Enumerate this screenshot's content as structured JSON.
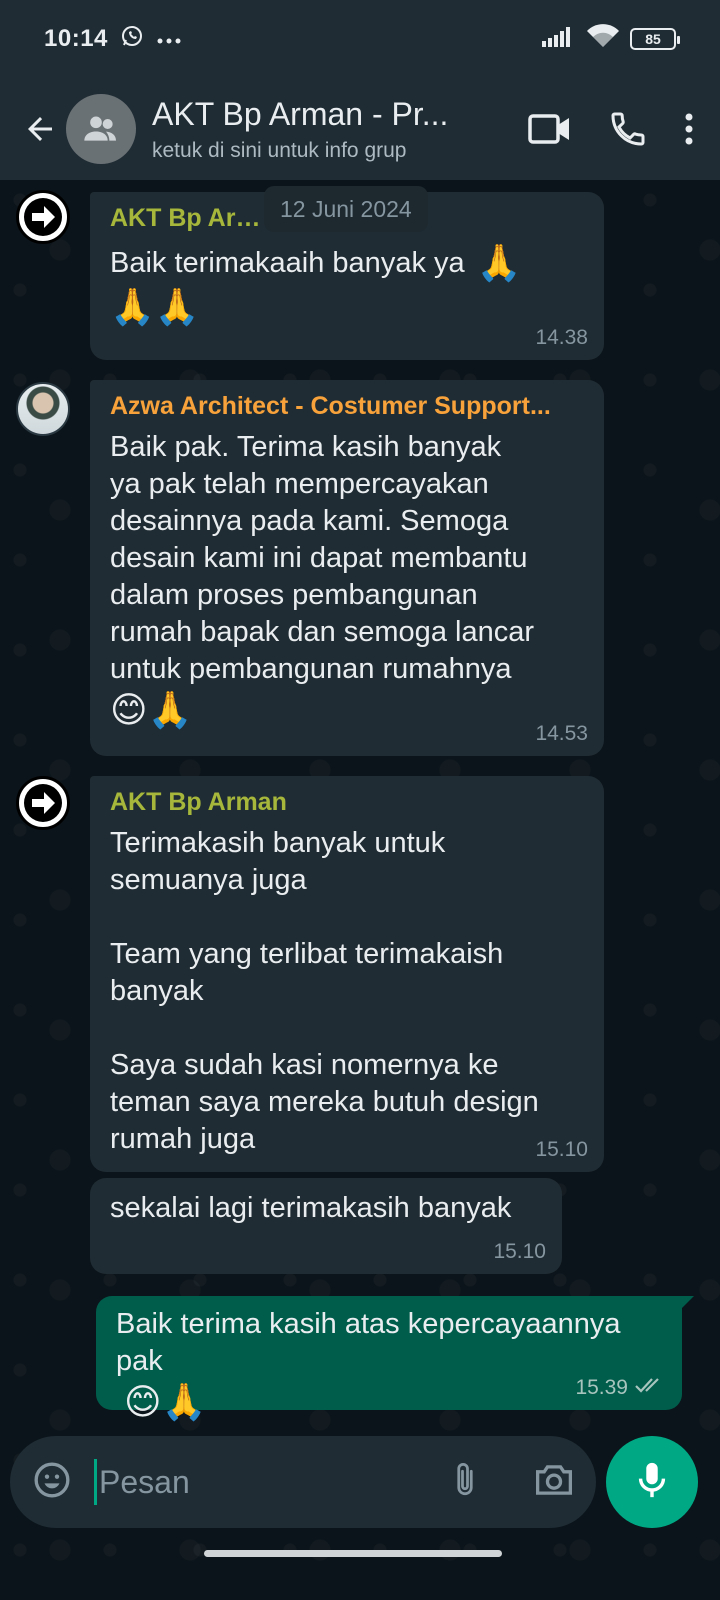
{
  "status_bar": {
    "time": "10:14",
    "battery": "85",
    "icons": [
      "whatsapp-icon",
      "more-dots-icon",
      "signal-icon",
      "wifi-icon",
      "battery-icon"
    ]
  },
  "header": {
    "title": "AKT Bp Arman - Pr...",
    "subtitle": "ketuk di sini untuk info grup",
    "icons": [
      "back-arrow-icon",
      "group-avatar-icon",
      "video-call-icon",
      "phone-call-icon",
      "more-vert-icon"
    ]
  },
  "date_chip": "12 Juni 2024",
  "messages": [
    {
      "sender": "AKT Bp Arman",
      "text": "Baik terimakaaih banyak ya",
      "emoji_line": "🙏🙏",
      "time": "14.38"
    },
    {
      "sender": "Azwa Architect - Costumer Support...",
      "text": "Baik pak. Terima kasih banyak\nya pak telah mempercayakan\ndesainnya pada kami. Semoga\ndesain kami ini dapat membantu\ndalam proses pembangunan\nrumah bapak dan semoga lancar\nuntuk pembangunan rumahnya",
      "emoji_line": "😊🙏",
      "time": "14.53"
    },
    {
      "sender": "AKT Bp Arman",
      "text": "Terimakasih banyak untuk\nsemuanya juga\n\nTeam yang terlibat terimakaish\nbanyak\n\nSaya sudah kasi nomernya ke\nteman saya mereka butuh design\nrumah juga",
      "time": "15.10"
    },
    {
      "text": "sekalai lagi terimakasih banyak",
      "time": "15.10"
    },
    {
      "text": "Baik terima kasih atas kepercayaannya\npak",
      "emoji_line": "😊🙏",
      "time": "15.39",
      "status": "read"
    }
  ],
  "composer": {
    "placeholder": "Pesan",
    "icons": [
      "emoji-icon",
      "attach-icon",
      "camera-icon",
      "mic-icon"
    ]
  },
  "colors": {
    "header_bg": "#1f2c34",
    "chat_bg": "#0b141a",
    "incoming_bubble": "#202c33",
    "outgoing_bubble": "#005c4b",
    "accent": "#00a884",
    "sender_olive": "#a6b73b",
    "sender_orange": "#f7a23a"
  }
}
